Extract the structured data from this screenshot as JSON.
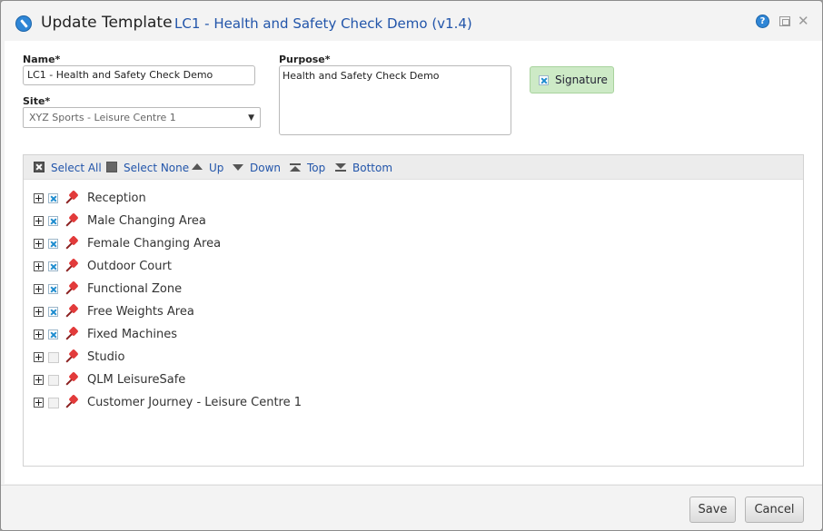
{
  "dialog": {
    "title": "Update Template",
    "subtitle": "LC1 - Health and Safety Check Demo (v1.4)",
    "help_glyph": "?",
    "close_glyph": "✕"
  },
  "form": {
    "name_label": "Name*",
    "name_value": "LC1 - Health and Safety Check Demo",
    "site_label": "Site*",
    "site_value": "XYZ Sports - Leisure Centre 1",
    "site_arrow": "▼",
    "purpose_label": "Purpose*",
    "purpose_value": "Health and Safety Check Demo",
    "signature_label": "Signature",
    "signature_checked": true
  },
  "toolbar": {
    "select_all": "Select All",
    "select_none": "Select None",
    "up": "Up",
    "down": "Down",
    "top": "Top",
    "bottom": "Bottom"
  },
  "tree": {
    "items": [
      {
        "label": "Reception",
        "checked": true
      },
      {
        "label": "Male Changing Area",
        "checked": true
      },
      {
        "label": "Female Changing Area",
        "checked": true
      },
      {
        "label": "Outdoor Court",
        "checked": true
      },
      {
        "label": "Functional Zone",
        "checked": true
      },
      {
        "label": "Free Weights Area",
        "checked": true
      },
      {
        "label": "Fixed Machines",
        "checked": true
      },
      {
        "label": "Studio",
        "checked": false
      },
      {
        "label": "QLM LeisureSafe",
        "checked": false
      },
      {
        "label": "Customer Journey - Leisure Centre 1",
        "checked": false
      }
    ]
  },
  "footer": {
    "save_label": "Save",
    "cancel_label": "Cancel"
  },
  "colors": {
    "accent": "#2255aa",
    "signature_bg": "#cdeac6",
    "check_blue": "#1e8ccf",
    "pin_red": "#e23b3b"
  }
}
